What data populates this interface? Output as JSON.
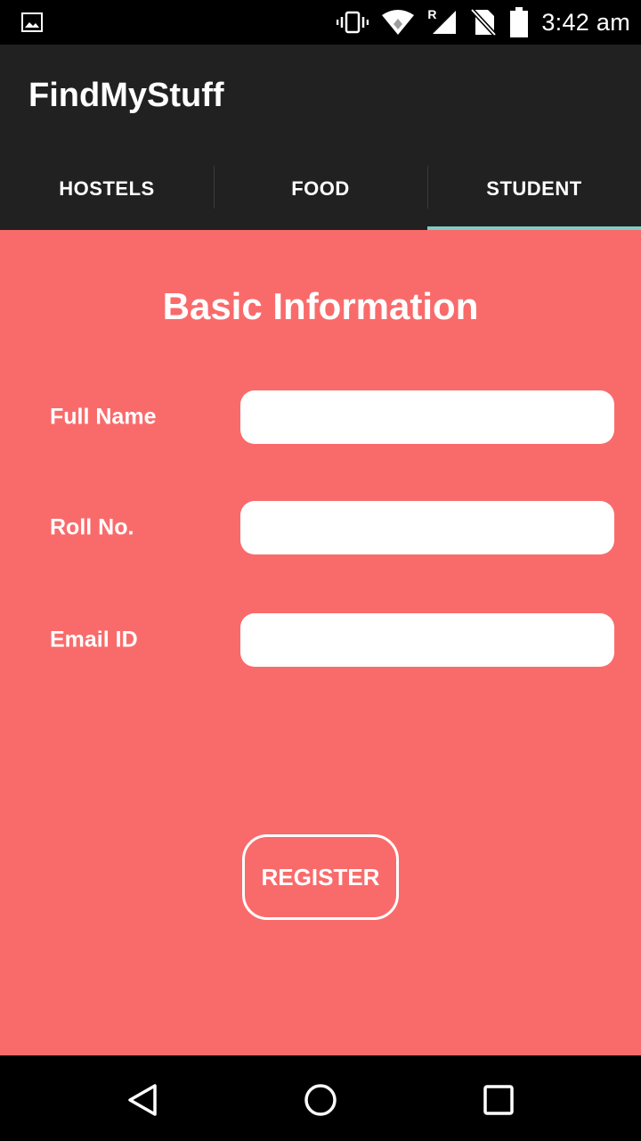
{
  "status_bar": {
    "time": "3:42 am",
    "icons": [
      "image-notification-icon",
      "vibrate-icon",
      "wifi-icon",
      "signal-roaming-icon",
      "no-sim-icon",
      "battery-icon"
    ],
    "roaming_label": "R"
  },
  "app_bar": {
    "title": "FindMyStuff"
  },
  "tabs": [
    {
      "label": "HOSTELS",
      "active": false
    },
    {
      "label": "FOOD",
      "active": false
    },
    {
      "label": "STUDENT",
      "active": true
    }
  ],
  "form": {
    "title": "Basic Information",
    "fields": [
      {
        "label": "Full Name",
        "value": ""
      },
      {
        "label": "Roll No.",
        "value": ""
      },
      {
        "label": "Email ID",
        "value": ""
      }
    ],
    "register_label": "REGISTER"
  },
  "nav_bar": {
    "icons": [
      "back-icon",
      "home-icon",
      "recents-icon"
    ]
  },
  "colors": {
    "content_background": "#f96b6b",
    "toolbar": "#212121",
    "tab_indicator": "#80cbc4"
  }
}
